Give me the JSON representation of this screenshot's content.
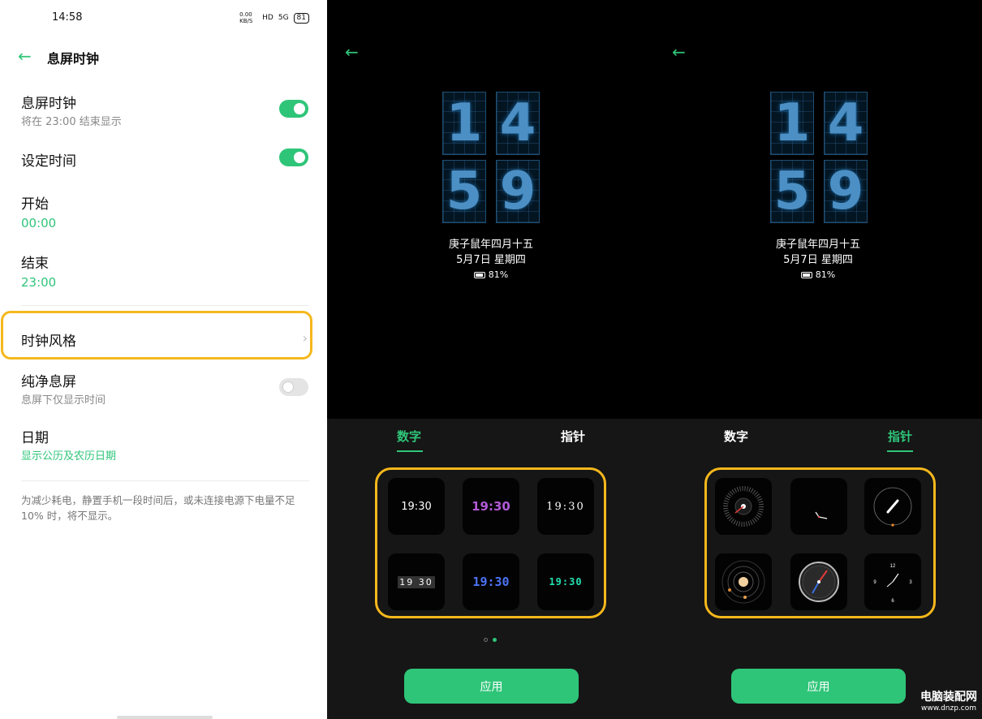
{
  "settings": {
    "status_time": "14:58",
    "status_net": "0.00 KB/S",
    "status_hd": "HD",
    "status_signal": "5G",
    "status_battery": "81",
    "title": "息屏时钟",
    "aod_title": "息屏时钟",
    "aod_sub": "将在 23:00 结束显示",
    "set_time_title": "设定时间",
    "start_label": "开始",
    "start_value": "00:00",
    "end_label": "结束",
    "end_value": "23:00",
    "clock_style_label": "时钟风格",
    "pure_title": "纯净息屏",
    "pure_sub": "息屏下仅显示时间",
    "date_title": "日期",
    "date_sub": "显示公历及农历日期",
    "note": "为减少耗电，静置手机一段时间后，或未连接电源下电量不足 10% 时，将不显示。",
    "toggles": {
      "aod": true,
      "set_time": true,
      "pure": false
    }
  },
  "preview": {
    "digits": [
      "1",
      "4",
      "5",
      "9"
    ],
    "lunar_date": "庚子鼠年四月十五",
    "solar_date": "5月7日 星期四",
    "battery": "81%"
  },
  "picker_digital": {
    "tab_digital": "数字",
    "tab_analog": "指针",
    "active_tab": "数字",
    "tiles": [
      "19:30",
      "19:30",
      "19:30",
      "19 30",
      "19:30",
      "19:30"
    ],
    "tile_colors": [
      "#ffffff",
      "#b25ad6",
      "#e0e0e0",
      "#ffffff",
      "#4d73f5",
      "#24e0b0"
    ],
    "page_indicator": {
      "count": 2,
      "active": 2
    },
    "apply_label": "应用"
  },
  "picker_analog": {
    "tab_digital": "数字",
    "tab_analog": "指针",
    "active_tab": "指针",
    "tiles": [
      "radial-clock",
      "minimal-hands-clock",
      "ring-clock",
      "orbit-clock",
      "compass-clock",
      "numeral-clock"
    ],
    "numeral_clock_labels": [
      "12",
      "3",
      "6",
      "9"
    ],
    "apply_label": "应用"
  },
  "watermark": {
    "title": "电脑装配网",
    "url": "www.dnzp.com"
  },
  "colors": {
    "accent": "#2fc579",
    "highlight": "#f5b81c"
  }
}
